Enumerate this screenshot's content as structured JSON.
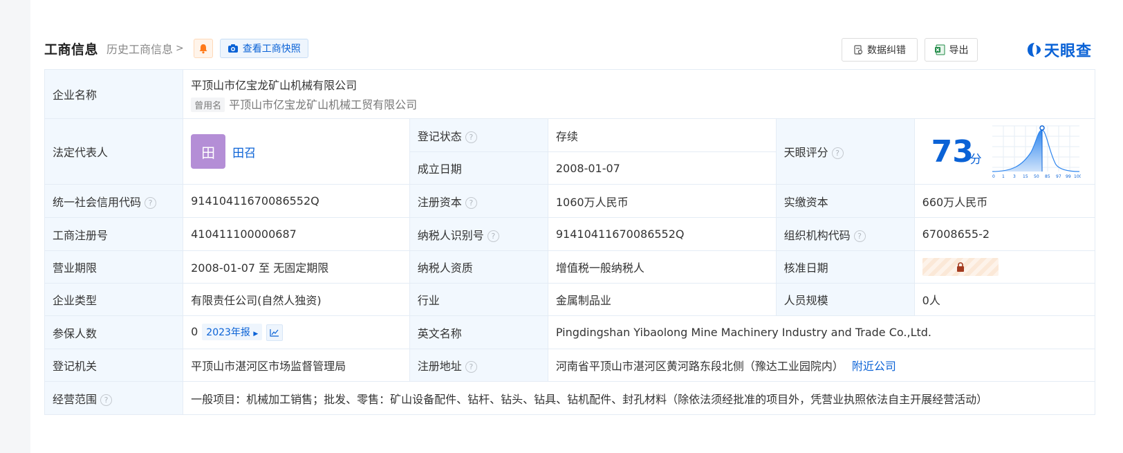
{
  "header": {
    "title": "工商信息",
    "history_label": "历史工商信息",
    "snapshot_label": "查看工商快照",
    "correct_label": "数据纠错",
    "export_label": "导出",
    "brand": "天眼查"
  },
  "company": {
    "name_label": "企业名称",
    "name": "平顶山市亿宝龙矿山机械有限公司",
    "former_tag": "曾用名",
    "former_name": "平顶山市亿宝龙矿山机械工贸有限公司",
    "legal_rep_label": "法定代表人",
    "legal_rep_avatar": "田",
    "legal_rep": "田召",
    "reg_status_label": "登记状态",
    "reg_status": "存续",
    "est_date_label": "成立日期",
    "est_date": "2008-01-07",
    "score_label": "天眼评分",
    "score": "73",
    "score_unit": "分",
    "credit_code_label": "统一社会信用代码",
    "credit_code": "91410411670086552Q",
    "reg_capital_label": "注册资本",
    "reg_capital": "1060万人民币",
    "paid_capital_label": "实缴资本",
    "paid_capital": "660万人民币",
    "reg_no_label": "工商注册号",
    "reg_no": "410411100000687",
    "taxpayer_id_label": "纳税人识别号",
    "taxpayer_id": "91410411670086552Q",
    "org_code_label": "组织机构代码",
    "org_code": "67008655-2",
    "term_label": "营业期限",
    "term": "2008-01-07 至 无固定期限",
    "taxpayer_type_label": "纳税人资质",
    "taxpayer_type": "增值税一般纳税人",
    "approve_date_label": "核准日期",
    "type_label": "企业类型",
    "type": "有限责任公司(自然人独资)",
    "industry_label": "行业",
    "industry": "金属制品业",
    "staff_label": "人员规模",
    "staff": "0人",
    "insured_label": "参保人数",
    "insured": "0",
    "insured_year": "2023年报",
    "english_label": "英文名称",
    "english": "Pingdingshan Yibaolong Mine Machinery Industry and Trade Co.,Ltd.",
    "authority_label": "登记机关",
    "authority": "平顶山市湛河区市场监督管理局",
    "address_label": "注册地址",
    "address": "河南省平顶山市湛河区黄河路东段北侧（豫达工业园院内）",
    "nearby_label": "附近公司",
    "scope_label": "经营范围",
    "scope": "一般项目：机械加工销售；批发、零售：矿山设备配件、钻杆、钻头、钻具、钻机配件、封孔材料（除依法须经批准的项目外，凭营业执照依法自主开展经营活动）"
  },
  "score_axis_ticks": [
    "0",
    "1",
    "3",
    "15",
    "50",
    "85",
    "97",
    "99",
    "100"
  ],
  "colors": {
    "accent": "#0a62d6",
    "status_green": "#1a9b3c",
    "label_bg": "#f2f8fe",
    "avatar": "#b48ed6"
  }
}
